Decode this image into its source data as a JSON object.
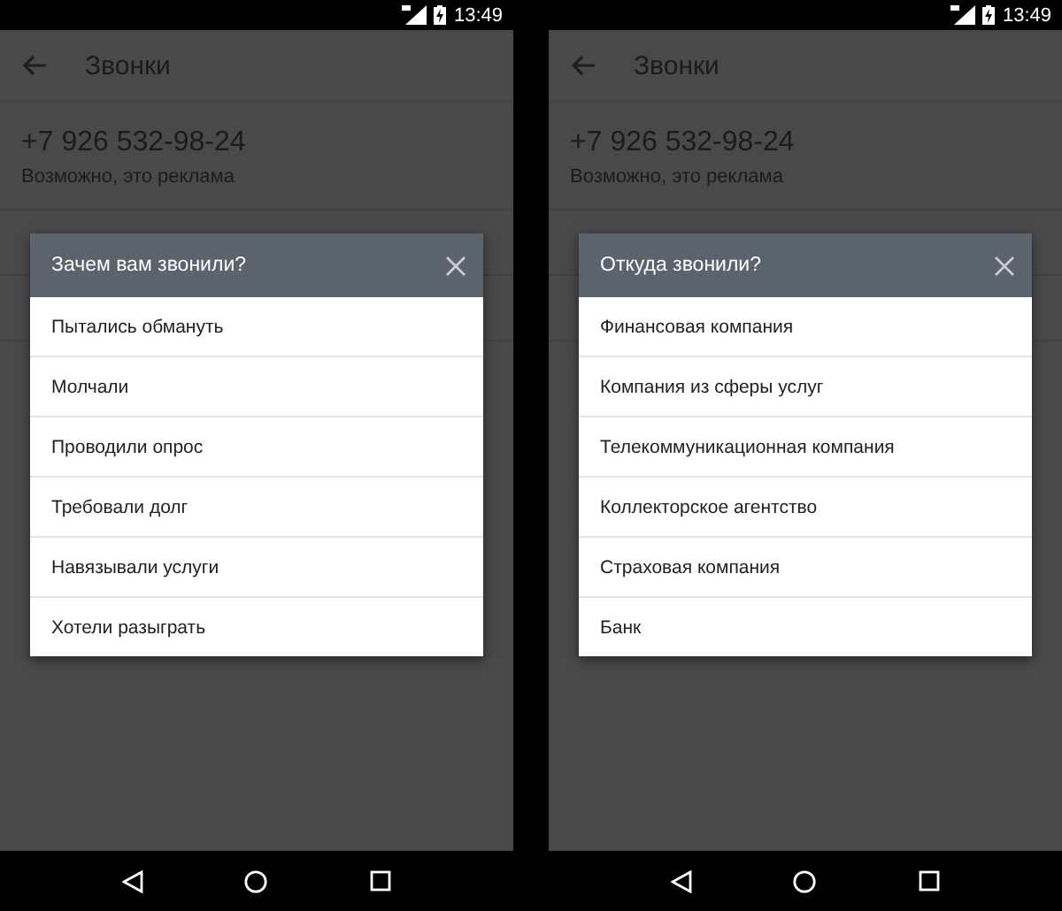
{
  "phones": [
    {
      "status_bar": {
        "time": "13:49"
      },
      "app_bar": {
        "title": "Звонки"
      },
      "contact": {
        "number": "+7 926 532-98-24",
        "note": "Возможно, это реклама"
      },
      "dialog": {
        "title": "Зачем вам звонили?",
        "options": [
          "Пытались обмануть",
          "Молчали",
          "Проводили опрос",
          "Требовали долг",
          "Навязывали услуги",
          "Хотели разыграть"
        ]
      }
    },
    {
      "status_bar": {
        "time": "13:49"
      },
      "app_bar": {
        "title": "Звонки"
      },
      "contact": {
        "number": "+7 926 532-98-24",
        "note": "Возможно, это реклама"
      },
      "dialog": {
        "title": "Откуда звонили?",
        "options": [
          "Финансовая компания",
          "Компания из сферы услуг",
          "Телекоммуникационная компания",
          "Коллекторское агентство",
          "Страховая компания",
          "Банк"
        ]
      }
    }
  ]
}
